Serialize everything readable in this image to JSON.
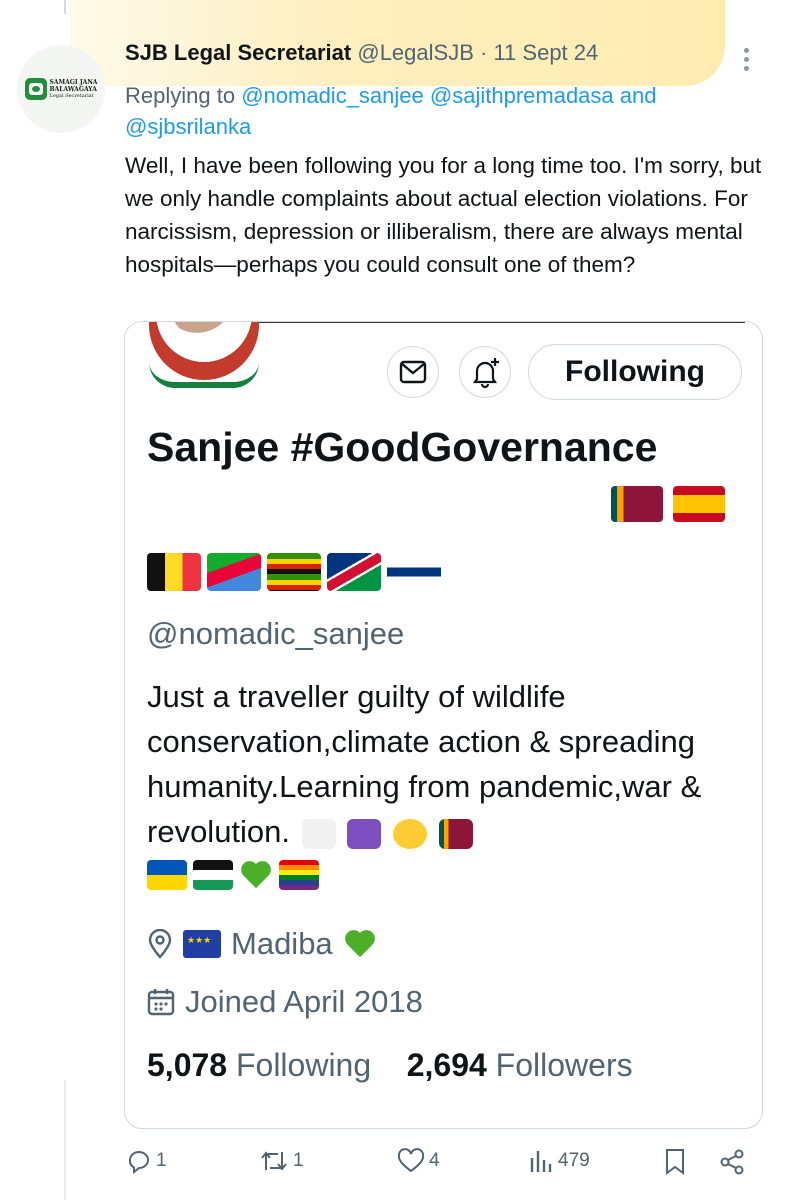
{
  "tweet": {
    "author_name": "SJB Legal Secretariat",
    "author_handle": "@LegalSJB",
    "separator": "·",
    "date": "11 Sept 24",
    "avatar_logo_lines": [
      "SAMAGI JANA",
      "BALAWAGAYA",
      "Legal Secretariat"
    ],
    "replying_prefix": "Replying to",
    "replying_to": [
      "@nomadic_sanjee",
      "@sajithpremadasa",
      "@sjbsrilanka"
    ],
    "replying_and": "and",
    "text": "Well, I have been following  you for a long time too. I'm sorry, but we only handle complaints about actual election violations. For narcissism, depression or illiberalism, there are always mental hospitals—perhaps you could consult one of them?"
  },
  "profile_card": {
    "display_name": "Sanjee #GoodGovernance",
    "handle": "@nomadic_sanjee",
    "follow_button": "Following",
    "bio": "Just a traveller guilty of wildlife conservation,climate action & spreading humanity.Learning from pandemic,war & revolution.",
    "location": "Madiba",
    "joined": "Joined April 2018",
    "following_count": "5,078",
    "following_label": "Following",
    "followers_count": "2,694",
    "followers_label": "Followers"
  },
  "actions": {
    "replies": "1",
    "reposts": "1",
    "likes": "4",
    "views": "479"
  },
  "colors": {
    "link": "#1d9bf0",
    "secondary_text": "#536471",
    "highlight": "#fde68c",
    "border": "#cfd9de"
  }
}
